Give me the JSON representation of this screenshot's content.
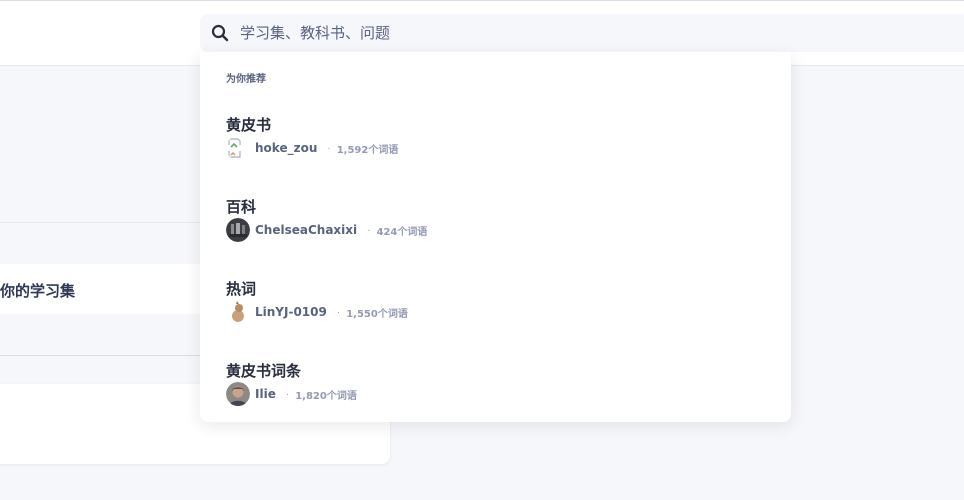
{
  "header": {
    "search": {
      "icon": "search-icon",
      "placeholder": "学习集、教科书、问题",
      "value": ""
    }
  },
  "background": {
    "set_card_label": "你的学习集"
  },
  "dropdown": {
    "section_label": "为你推荐",
    "items": [
      {
        "title": "黄皮书",
        "username": "hoke_zou",
        "separator": "·",
        "terms": "1,592个词语",
        "avatar": "broken-image-icon"
      },
      {
        "title": "百科",
        "username": "ChelseaChaxixi",
        "separator": "·",
        "terms": "424个词语",
        "avatar": "user-avatar"
      },
      {
        "title": "热词",
        "username": "LinYJ-0109",
        "separator": "·",
        "terms": "1,550个词语",
        "avatar": "user-avatar"
      },
      {
        "title": "黄皮书词条",
        "username": "Ilie",
        "separator": "·",
        "terms": "1,820个词语",
        "avatar": "user-avatar"
      }
    ]
  }
}
